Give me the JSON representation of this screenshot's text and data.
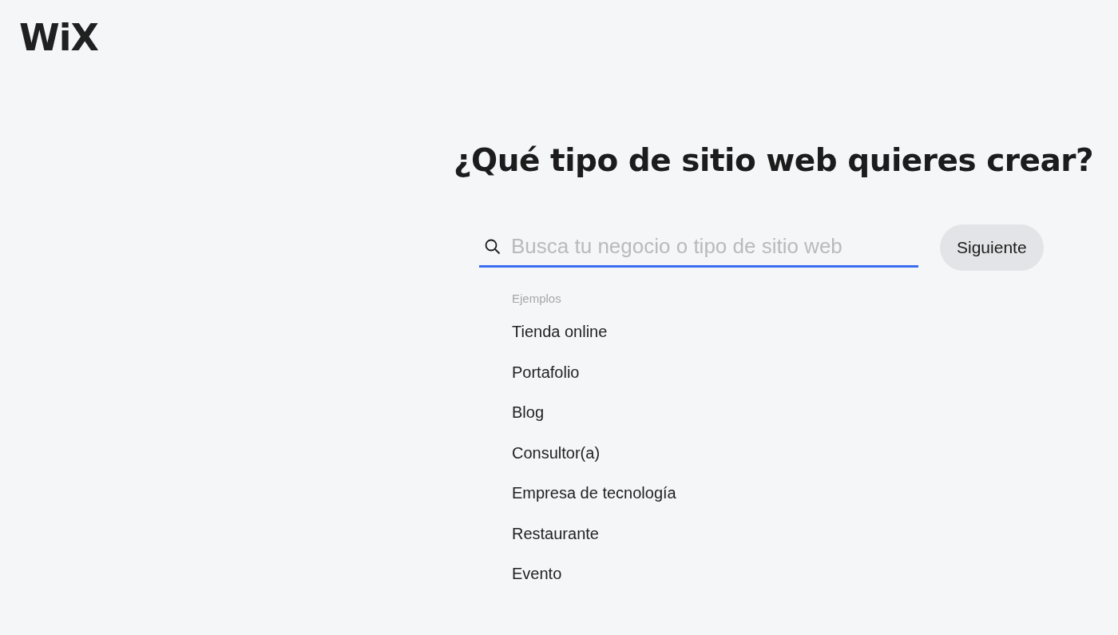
{
  "logo": "WiX",
  "heading": "¿Qué tipo de sitio web quieres crear?",
  "search": {
    "placeholder": "Busca tu negocio o tipo de sitio web",
    "focused": true
  },
  "next_button": "Siguiente",
  "examples": {
    "label": "Ejemplos",
    "items": [
      {
        "label": "Tienda online"
      },
      {
        "label": "Portafolio"
      },
      {
        "label": "Blog"
      },
      {
        "label": "Consultor(a)"
      },
      {
        "label": "Empresa de tecnología"
      },
      {
        "label": "Restaurante"
      },
      {
        "label": "Evento"
      }
    ]
  }
}
